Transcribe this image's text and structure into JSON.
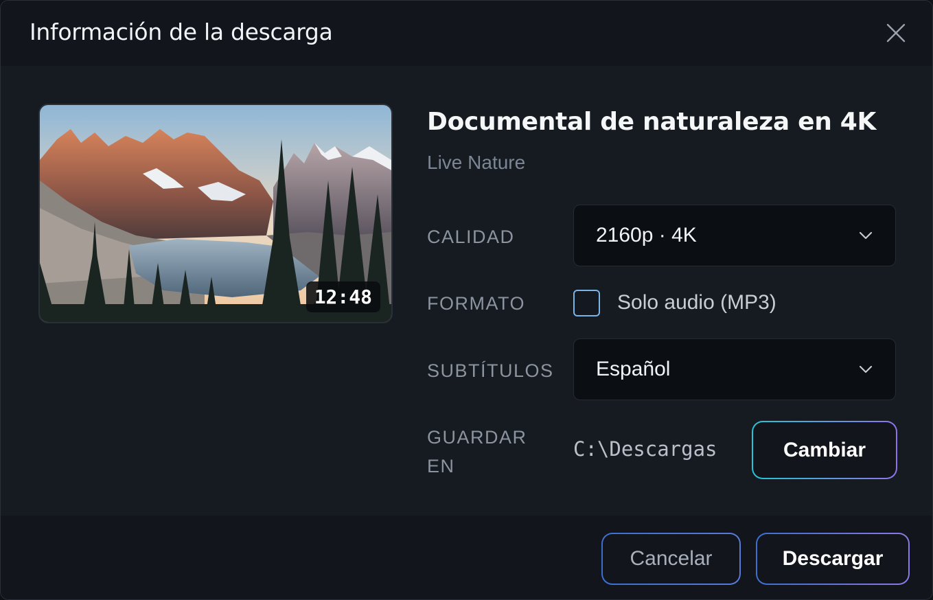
{
  "dialog": {
    "title": "Información de la descarga",
    "close_icon": "close-icon"
  },
  "video": {
    "title": "Documental de naturaleza en 4K",
    "channel": "Live Nature",
    "duration": "12:48",
    "thumbnail": "mountain-lake-landscape"
  },
  "fields": {
    "quality_label": "CALIDAD",
    "quality_value": "2160p · 4K",
    "format_label": "FORMATO",
    "audio_only_label": "Solo audio (MP3)",
    "audio_only_checked": false,
    "subtitles_label": "SUBTÍTULOS",
    "subtitles_value": "Español",
    "save_label_line1": "GUARDAR",
    "save_label_line2": "EN",
    "save_path": "C:\\Descargas",
    "change_button": "Cambiar"
  },
  "footer": {
    "cancel_label": "Cancelar",
    "download_label": "Descargar"
  },
  "colors": {
    "accent_cyan": "#22c7d8",
    "accent_purple": "#8f74e6",
    "accent_blue": "#3d6fd1",
    "background": "#161a21"
  }
}
